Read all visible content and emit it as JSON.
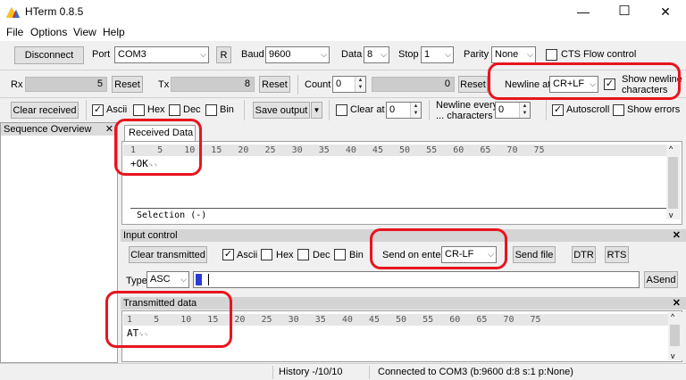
{
  "window": {
    "title": "HTerm 0.8.5",
    "minimize": "—",
    "maximize": "☐",
    "close": "✕"
  },
  "menu": [
    "File",
    "Options",
    "View",
    "Help"
  ],
  "connection": {
    "disconnect_label": "Disconnect",
    "port_label": "Port",
    "port_value": "COM3",
    "refresh_label": "R",
    "baud_label": "Baud",
    "baud_value": "9600",
    "data_label": "Data",
    "data_value": "8",
    "stop_label": "Stop",
    "stop_value": "1",
    "parity_label": "Parity",
    "parity_value": "None",
    "cts_label": "CTS Flow control"
  },
  "counters": {
    "rx_label": "Rx",
    "rx_value": "5",
    "rx_reset": "Reset",
    "tx_label": "Tx",
    "tx_value": "8",
    "tx_reset": "Reset",
    "count_label": "Count",
    "count_value": "0",
    "count_display": "0",
    "count_reset": "Reset",
    "newline_at_label": "Newline at",
    "newline_at_value": "CR+LF",
    "show_newline_label_1": "Show newline",
    "show_newline_label_2": "characters"
  },
  "display": {
    "clear_received": "Clear received",
    "ascii": "Ascii",
    "hex": "Hex",
    "dec": "Dec",
    "bin": "Bin",
    "save_output": "Save output",
    "clear_at": "Clear at",
    "clear_at_value": "0",
    "newline_every_1": "Newline every",
    "newline_every_2": "... characters",
    "newline_every_value": "0",
    "autoscroll": "Autoscroll",
    "show_errors": "Show errors"
  },
  "sequence": {
    "title": "Sequence Overview",
    "close": "✕"
  },
  "received": {
    "tab": "Received Data",
    "ruler": "1    5    10   15   20   25   30   35   40   45   50   55   60   65   70   75",
    "text": "+OK",
    "newline_glyph": "␍␊",
    "selection": "Selection (-)"
  },
  "input": {
    "header": "Input control",
    "close": "✕",
    "clear_transmitted": "Clear transmitted",
    "ascii": "Ascii",
    "hex": "Hex",
    "dec": "Dec",
    "bin": "Bin",
    "send_on_enter_label": "Send on enter",
    "send_on_enter_value": "CR-LF",
    "send_file": "Send file",
    "dtr": "DTR",
    "rts": "RTS",
    "type_label": "Type",
    "type_value": "ASC",
    "asend": "ASend"
  },
  "transmitted": {
    "header": "Transmitted data",
    "close": "✕",
    "ruler": "1    5    10   15   20   25   30   35   40   45   50   55   60   65   70   75",
    "text": "AT",
    "newline_glyph": "␍␊"
  },
  "status": {
    "history": "History -/10/10",
    "connection": "Connected to COM3 (b:9600 d:8 s:1 p:None)"
  },
  "colors": {
    "highlight": "#e8141e",
    "cursor": "#2b3bd6"
  }
}
